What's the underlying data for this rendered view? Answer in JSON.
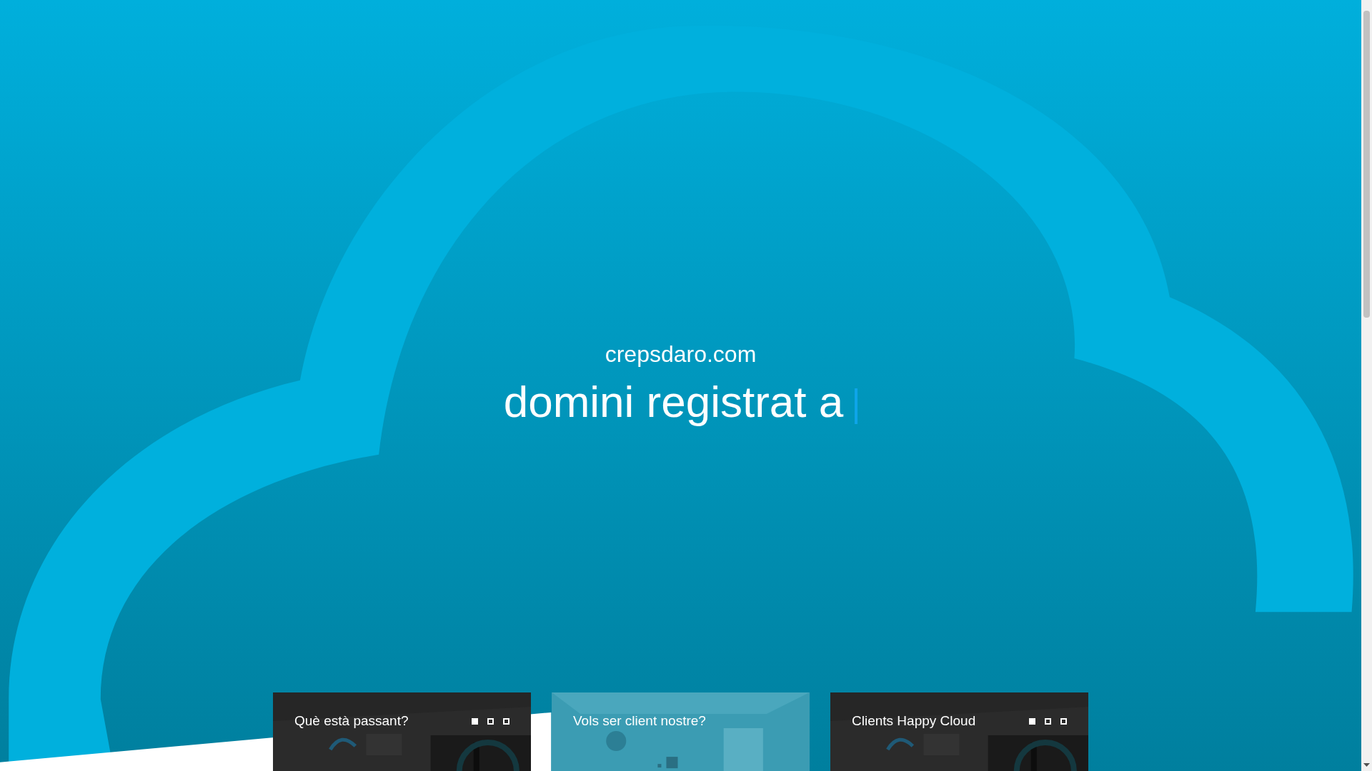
{
  "hero": {
    "domain": "crepsdaro.com",
    "headline": "domini registrat a"
  },
  "cards": [
    {
      "title": "Què està passant?",
      "kind": "dark",
      "dots": [
        {
          "selected": true
        },
        {
          "selected": false
        },
        {
          "selected": false
        }
      ]
    },
    {
      "title": "Vols ser client nostre?",
      "kind": "teal"
    },
    {
      "title": "Clients Happy Cloud",
      "kind": "dark",
      "dots": [
        {
          "selected": true
        },
        {
          "selected": false
        },
        {
          "selected": false
        }
      ]
    }
  ]
}
